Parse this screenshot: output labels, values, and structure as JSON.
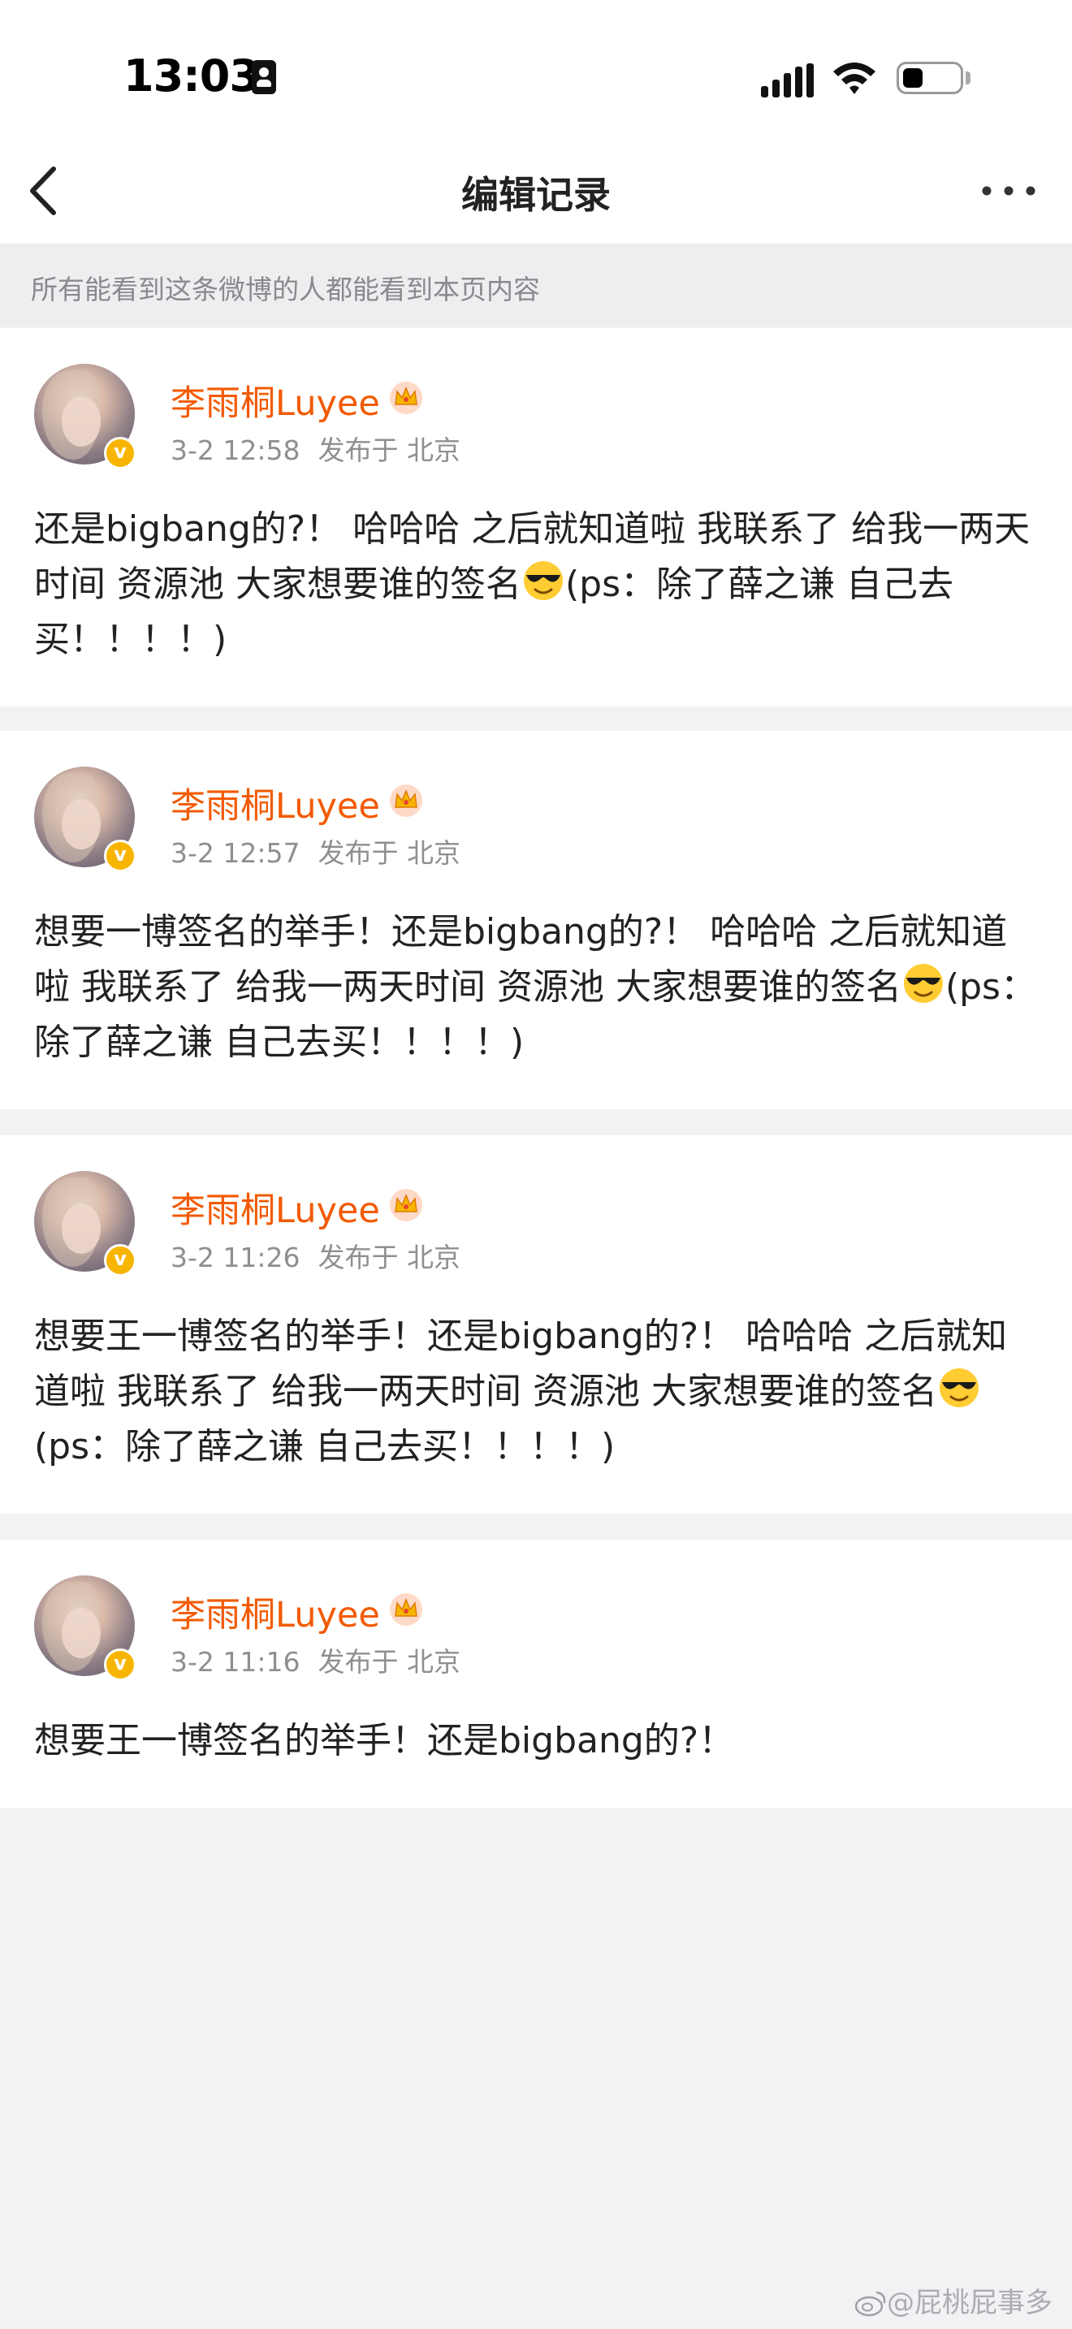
{
  "status_bar": {
    "time": "13:03"
  },
  "nav": {
    "title": "编辑记录"
  },
  "notice": {
    "text": "所有能看到这条微博的人都能看到本页内容"
  },
  "posts": [
    {
      "author": "李雨桐Luyee",
      "time": "3-2 12:58",
      "location": "发布于 北京",
      "text_before_emoji": "还是bigbang的?！ 哈哈哈 之后就知道啦 我联系了 给我一两天时间 资源池 大家想要谁的签名",
      "text_after_emoji": "(ps：除了薛之谦 自己去买！！！！)"
    },
    {
      "author": "李雨桐Luyee",
      "time": "3-2 12:57",
      "location": "发布于 北京",
      "text_before_emoji": "想要一博签名的举手！还是bigbang的?！ 哈哈哈 之后就知道啦 我联系了 给我一两天时间 资源池 大家想要谁的签名",
      "text_after_emoji": "(ps：除了薛之谦 自己去买！！！！)"
    },
    {
      "author": "李雨桐Luyee",
      "time": "3-2 11:26",
      "location": "发布于 北京",
      "text_before_emoji": "想要王一博签名的举手！还是bigbang的?！ 哈哈哈 之后就知道啦 我联系了 给我一两天时间 资源池 大家想要谁的签名",
      "text_after_emoji": "(ps：除了薛之谦 自己去买！！！！)"
    },
    {
      "author": "李雨桐Luyee",
      "time": "3-2 11:16",
      "location": "发布于 北京",
      "text": "想要王一博签名的举手！还是bigbang的?！"
    }
  ],
  "watermark": {
    "text": "@屁桃屁事多"
  },
  "icons": {
    "back": "chevron-left-icon",
    "more": "more-dots-icon",
    "verified": "verified-badge-icon",
    "crown": "crown-icon",
    "emoji": "cool-sunglasses-emoji"
  },
  "colors": {
    "accent_name": "#f25a00",
    "verified": "#f7b500"
  }
}
